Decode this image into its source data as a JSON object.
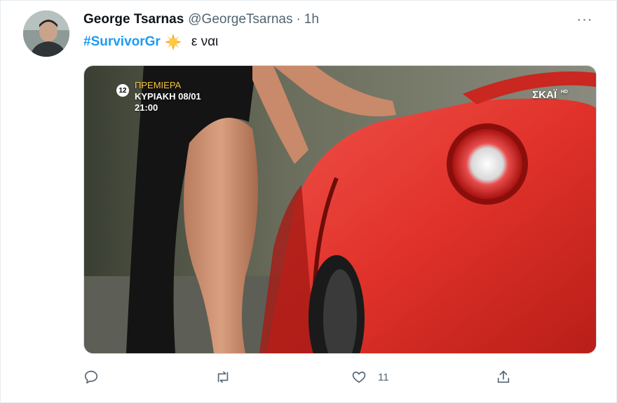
{
  "tweet": {
    "author": {
      "display_name": "George Tsarnas",
      "handle": "@GeorgeTsarnas",
      "time": "1h",
      "separator": "·"
    },
    "more_label": "···",
    "hashtag": "#SurvivorGr",
    "emoji_icon": "sun-emoji-icon",
    "text": "ε ναι",
    "media": {
      "premiere_label": "ΠΡΕΜΙΕΡΑ",
      "date_label": "ΚΥΡΙΑΚΗ 08/01",
      "time_label": "21:00",
      "channel_rating": "12",
      "channel_logo": "ΣΚΑΪ",
      "channel_hd": "HD"
    },
    "actions": {
      "reply_icon": "reply-icon",
      "retweet_icon": "retweet-icon",
      "like_icon": "heart-icon",
      "like_count": "11",
      "share_icon": "share-icon"
    }
  },
  "colors": {
    "accent": "#1d9bf0",
    "text_secondary": "#536471",
    "car_red": "#e0322a"
  }
}
